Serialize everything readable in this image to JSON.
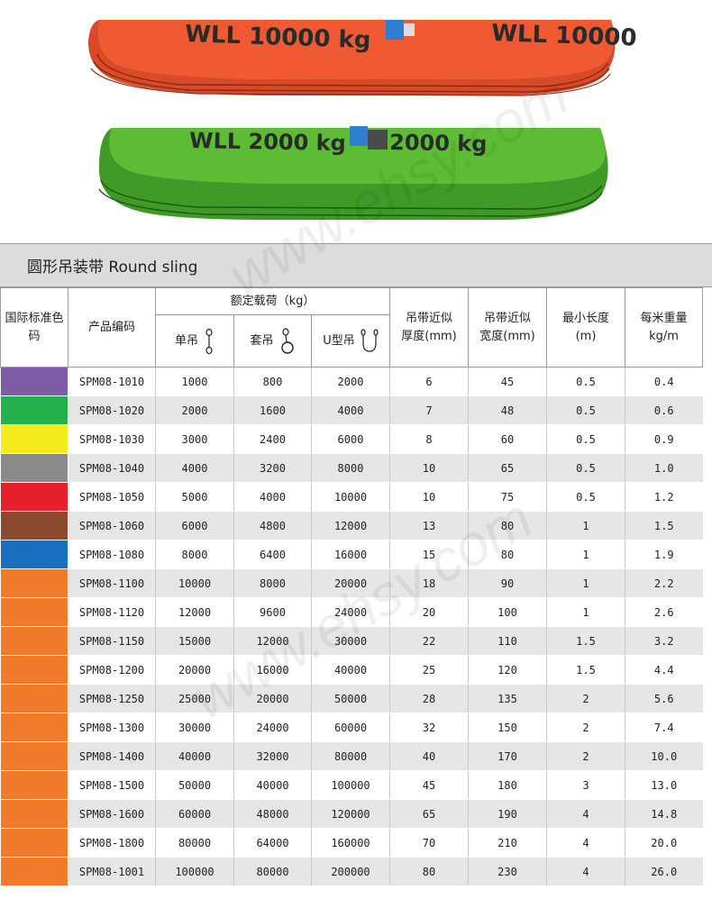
{
  "slings": {
    "top_label": "WLL 10000 kg",
    "top_label_repeat": "WLL 10000",
    "bottom_label": "WLL 2000 kg",
    "bottom_label_repeat": "2000 kg",
    "top_color": "#e8552e",
    "bottom_color": "#55b532"
  },
  "watermark": "www.ehsy.com",
  "table": {
    "title": "圆形吊装带 Round sling",
    "headers": {
      "color_code": "国际标准色码",
      "product_code": "产品编码",
      "rated_load": "额定载荷（kg）",
      "single": "单吊",
      "choker": "套吊",
      "basket": "U型吊",
      "thickness": "吊带近似厚度(mm)",
      "width": "吊带近似宽度(mm)",
      "min_length": "最小长度(m)",
      "weight": "每米重量kg/m"
    },
    "rows": [
      {
        "color": "#7e5ba6",
        "code": "SPM08-1010",
        "single": "1000",
        "choker": "800",
        "basket": "2000",
        "thickness": "6",
        "width": "45",
        "min_length": "0.5",
        "weight": "0.4"
      },
      {
        "color": "#24b04a",
        "code": "SPM08-1020",
        "single": "2000",
        "choker": "1600",
        "basket": "4000",
        "thickness": "7",
        "width": "48",
        "min_length": "0.5",
        "weight": "0.6"
      },
      {
        "color": "#f4ea1c",
        "code": "SPM08-1030",
        "single": "3000",
        "choker": "2400",
        "basket": "6000",
        "thickness": "8",
        "width": "60",
        "min_length": "0.5",
        "weight": "0.9"
      },
      {
        "color": "#8a8a8a",
        "code": "SPM08-1040",
        "single": "4000",
        "choker": "3200",
        "basket": "8000",
        "thickness": "10",
        "width": "65",
        "min_length": "0.5",
        "weight": "1.0"
      },
      {
        "color": "#e6202d",
        "code": "SPM08-1050",
        "single": "5000",
        "choker": "4000",
        "basket": "10000",
        "thickness": "10",
        "width": "75",
        "min_length": "0.5",
        "weight": "1.2"
      },
      {
        "color": "#8b4a2e",
        "code": "SPM08-1060",
        "single": "6000",
        "choker": "4800",
        "basket": "12000",
        "thickness": "13",
        "width": "80",
        "min_length": "1",
        "weight": "1.5"
      },
      {
        "color": "#1b6fc0",
        "code": "SPM08-1080",
        "single": "8000",
        "choker": "6400",
        "basket": "16000",
        "thickness": "15",
        "width": "80",
        "min_length": "1",
        "weight": "1.9"
      },
      {
        "color": "#ef7b2a",
        "code": "SPM08-1100",
        "single": "10000",
        "choker": "8000",
        "basket": "20000",
        "thickness": "18",
        "width": "90",
        "min_length": "1",
        "weight": "2.2"
      },
      {
        "color": "#ef7b2a",
        "code": "SPM08-1120",
        "single": "12000",
        "choker": "9600",
        "basket": "24000",
        "thickness": "20",
        "width": "100",
        "min_length": "1",
        "weight": "2.6"
      },
      {
        "color": "#ef7b2a",
        "code": "SPM08-1150",
        "single": "15000",
        "choker": "12000",
        "basket": "30000",
        "thickness": "22",
        "width": "110",
        "min_length": "1.5",
        "weight": "3.2"
      },
      {
        "color": "#ef7b2a",
        "code": "SPM08-1200",
        "single": "20000",
        "choker": "16000",
        "basket": "40000",
        "thickness": "25",
        "width": "120",
        "min_length": "1.5",
        "weight": "4.4"
      },
      {
        "color": "#ef7b2a",
        "code": "SPM08-1250",
        "single": "25000",
        "choker": "20000",
        "basket": "50000",
        "thickness": "28",
        "width": "135",
        "min_length": "2",
        "weight": "5.6"
      },
      {
        "color": "#ef7b2a",
        "code": "SPM08-1300",
        "single": "30000",
        "choker": "24000",
        "basket": "60000",
        "thickness": "32",
        "width": "150",
        "min_length": "2",
        "weight": "7.4"
      },
      {
        "color": "#ef7b2a",
        "code": "SPM08-1400",
        "single": "40000",
        "choker": "32000",
        "basket": "80000",
        "thickness": "40",
        "width": "170",
        "min_length": "2",
        "weight": "10.0"
      },
      {
        "color": "#ef7b2a",
        "code": "SPM08-1500",
        "single": "50000",
        "choker": "40000",
        "basket": "100000",
        "thickness": "45",
        "width": "180",
        "min_length": "3",
        "weight": "13.0"
      },
      {
        "color": "#ef7b2a",
        "code": "SPM08-1600",
        "single": "60000",
        "choker": "48000",
        "basket": "120000",
        "thickness": "65",
        "width": "190",
        "min_length": "4",
        "weight": "14.8"
      },
      {
        "color": "#ef7b2a",
        "code": "SPM08-1800",
        "single": "80000",
        "choker": "64000",
        "basket": "160000",
        "thickness": "70",
        "width": "210",
        "min_length": "4",
        "weight": "20.0"
      },
      {
        "color": "#ef7b2a",
        "code": "SPM08-1001",
        "single": "100000",
        "choker": "80000",
        "basket": "200000",
        "thickness": "80",
        "width": "230",
        "min_length": "4",
        "weight": "26.0"
      }
    ]
  }
}
